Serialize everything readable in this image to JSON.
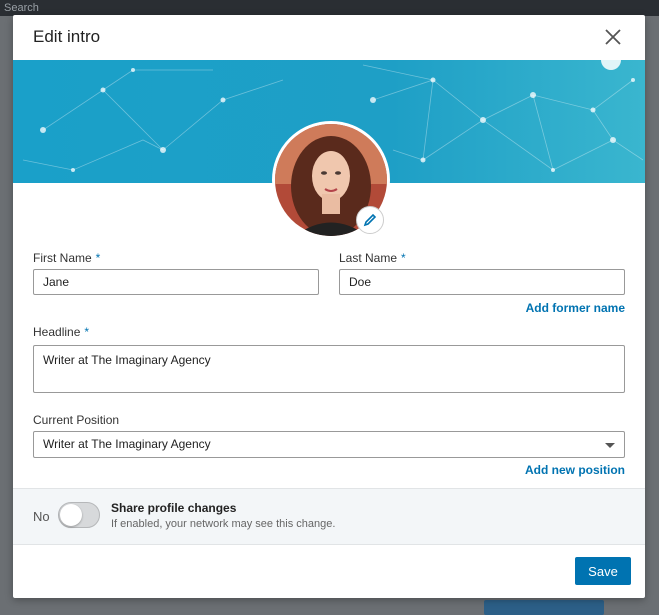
{
  "background": {
    "search_text": "Search"
  },
  "modal": {
    "title": "Edit intro",
    "close_icon": "close-icon"
  },
  "form": {
    "first_name": {
      "label": "First Name",
      "required": "*",
      "value": "Jane"
    },
    "last_name": {
      "label": "Last Name",
      "required": "*",
      "value": "Doe"
    },
    "add_former_name": "Add former name",
    "headline": {
      "label": "Headline",
      "required": "*",
      "value": "Writer at The Imaginary Agency"
    },
    "current_position": {
      "label": "Current Position",
      "value": "Writer at The Imaginary Agency"
    },
    "add_new_position": "Add new position"
  },
  "share": {
    "toggle_state": "No",
    "title": "Share profile changes",
    "subtitle": "If enabled, your network may see this change."
  },
  "footer": {
    "save_label": "Save"
  },
  "colors": {
    "accent": "#0073b1",
    "banner": "#1aa0c9"
  }
}
